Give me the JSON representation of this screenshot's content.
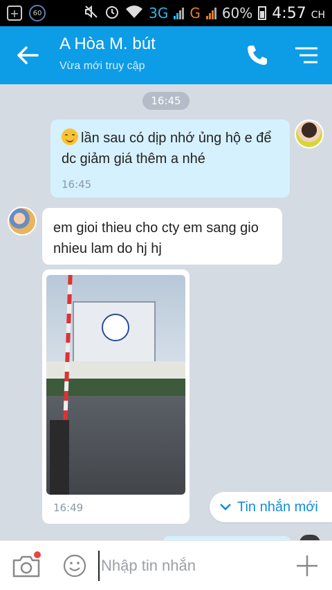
{
  "status_bar": {
    "notif_plus": "+",
    "notif_count": "60",
    "net1": "3G",
    "net2": "G",
    "battery": "60%",
    "time": "4:57",
    "time_suffix": "CH"
  },
  "header": {
    "title": "A Hòa M. bút",
    "subtitle": "Vừa mới truy cập",
    "bg_color": "#0d9ce6"
  },
  "chat": {
    "time_separator": "16:45",
    "messages": [
      {
        "sender": "me",
        "text": "lần sau  có dịp nhớ ủng hộ e để dc giảm giá thêm a nhé",
        "time": "16:45"
      },
      {
        "sender": "other",
        "text": "em gioi thieu cho cty em sang gio nhieu lam do hj hj"
      },
      {
        "sender": "other",
        "type": "photo",
        "time": "16:49"
      }
    ],
    "new_message_label": "Tin nhắn mới"
  },
  "input": {
    "placeholder": "Nhập tin nhắn",
    "value": ""
  }
}
